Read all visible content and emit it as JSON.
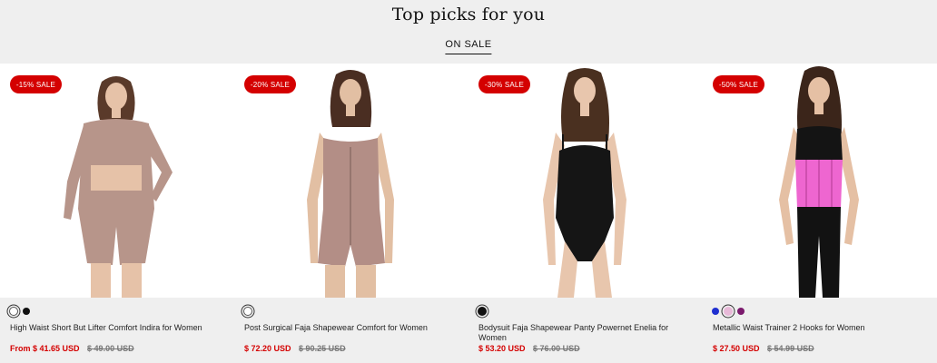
{
  "section": {
    "title": "Top picks for you",
    "tab_label": "ON SALE"
  },
  "products": [
    {
      "badge": "-15% SALE",
      "name": "High Waist Short But Lifter Comfort Indira for Women",
      "price": "From $ 41.65 USD",
      "old_price": "$ 49.00 USD",
      "swatches": [
        "#ffffff",
        "#111111"
      ],
      "garment_color": "#b7958a"
    },
    {
      "badge": "-20% SALE",
      "name": "Post Surgical Faja Shapewear Comfort for Women",
      "price": "$ 72.20 USD",
      "old_price": "$ 90.25 USD",
      "swatches": [
        "#ffffff"
      ],
      "garment_color": "#b38e86"
    },
    {
      "badge": "-30% SALE",
      "name": "Bodysuit Faja Shapewear Panty Powernet Enelia for Women",
      "price": "$ 53.20 USD",
      "old_price": "$ 76.00 USD",
      "swatches": [
        "#111111"
      ],
      "garment_color": "#151515"
    },
    {
      "badge": "-50% SALE",
      "name": "Metallic Waist Trainer 2 Hooks for Women",
      "price": "$ 27.50 USD",
      "old_price": "$ 54.99 USD",
      "swatches": [
        "#1f2fd0",
        "#e8b9d8",
        "#7b1a6d"
      ],
      "garment_color": "#ee66d0"
    }
  ],
  "colors": {
    "sale_red": "#d40000",
    "background": "#efefef"
  }
}
